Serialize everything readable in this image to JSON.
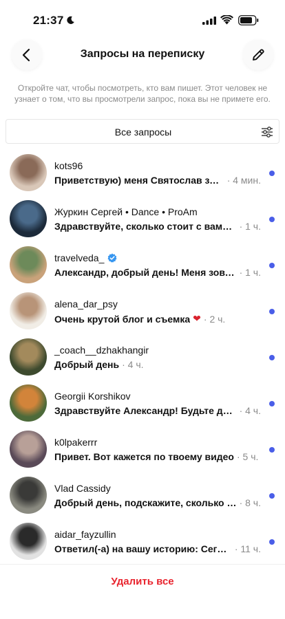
{
  "status_bar": {
    "time": "21:37"
  },
  "header": {
    "title": "Запросы на переписку"
  },
  "info_text": "Откройте чат, чтобы посмотреть, кто вам пишет. Этот человек не узнает о том, что вы просмотрели запрос, пока вы не примете его.",
  "filter": {
    "label": "Все запросы"
  },
  "colors": {
    "accent": "#4a5ee8",
    "danger": "#e8242e",
    "verified": "#3897f0"
  },
  "requests": [
    {
      "name": "kots96",
      "message": "Приветствую) меня Святослав зовут",
      "time": "· 4 мин.",
      "verified": false,
      "heart": false,
      "avatar": [
        "#d9c7b8",
        "#8a6a58"
      ]
    },
    {
      "name": "Журкин Сергей • Dance • ProAm",
      "message": "Здравствуйте, сколько стоит с вами съемка",
      "time": "· 1 ч.",
      "verified": false,
      "heart": false,
      "avatar": [
        "#1c2a3a",
        "#4a6a8a"
      ]
    },
    {
      "name": "travelveda_",
      "message": "Александр, добрый день! Меня зовут Веда",
      "time": "· 1 ч.",
      "verified": true,
      "heart": false,
      "avatar": [
        "#c9a27a",
        "#6d8a5a"
      ]
    },
    {
      "name": "alena_dar_psy",
      "message": "Очень крутой блог и съемка",
      "time": "· 2 ч.",
      "verified": false,
      "heart": true,
      "avatar": [
        "#f1ede6",
        "#b89478"
      ]
    },
    {
      "name": "_coach__dzhakhangir",
      "message": "Добрый день",
      "time": "· 4 ч.",
      "verified": false,
      "heart": false,
      "avatar": [
        "#3d4a2e",
        "#a38a5c"
      ]
    },
    {
      "name": "Georgii Korshikov",
      "message": "Здравствуйте Александр! Будьте добры",
      "time": "· 4 ч.",
      "verified": false,
      "heart": false,
      "avatar": [
        "#4d6a3a",
        "#d2843a"
      ]
    },
    {
      "name": "k0lpakerrr",
      "message": "Привет. Вот кажется по твоему видео",
      "time": "· 5 ч.",
      "verified": false,
      "heart": false,
      "avatar": [
        "#5a4a58",
        "#b8a098"
      ]
    },
    {
      "name": "Vlad Cassidy",
      "message": "Добрый день, подскажите, сколько стоит",
      "time": "· 8 ч.",
      "verified": false,
      "heart": false,
      "avatar": [
        "#8a8a80",
        "#3a3a38"
      ]
    },
    {
      "name": "aidar_fayzullin",
      "message": "Ответил(-а) на вашу историю: Сегодня",
      "time": "· 11 ч.",
      "verified": false,
      "heart": false,
      "avatar": [
        "#e2e2e2",
        "#2a2a2a"
      ]
    }
  ],
  "footer": {
    "delete_all": "Удалить все"
  }
}
